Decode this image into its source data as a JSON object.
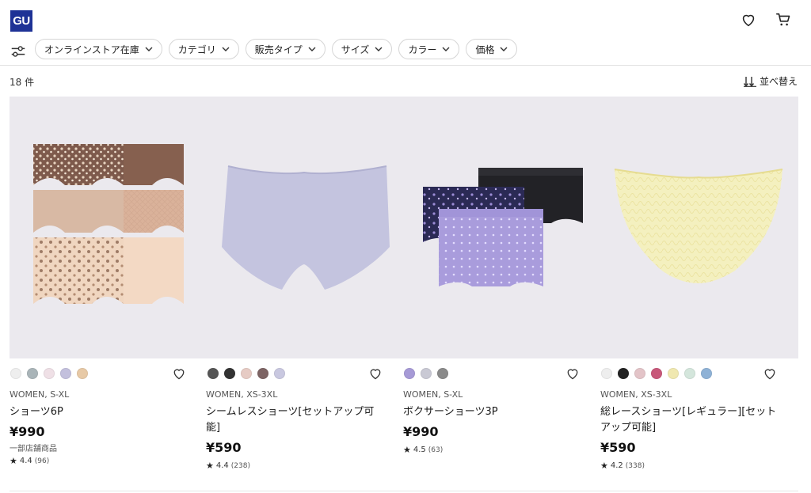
{
  "header": {
    "logo_text": "GU",
    "logo_color": "#1e3296",
    "icons": [
      "heart-icon",
      "cart-icon"
    ]
  },
  "filters": {
    "icon": "filter-sliders-icon",
    "chips": [
      {
        "label": "オンラインストア在庫"
      },
      {
        "label": "カテゴリ"
      },
      {
        "label": "販売タイプ"
      },
      {
        "label": "サイズ"
      },
      {
        "label": "カラー"
      },
      {
        "label": "価格"
      }
    ]
  },
  "results": {
    "count": "18 件",
    "sort_label": "並べ替え"
  },
  "products": [
    {
      "colors": [
        "#eeeeee",
        "#a9b4b8",
        "#efe0e6",
        "#c3c0dd",
        "#e7c9a6"
      ],
      "meta": "WOMEN, S-XL",
      "name": "ショーツ6P",
      "price": "¥990",
      "note": "一部店舗商品",
      "rating": "4.4",
      "reviews": "(96)"
    },
    {
      "colors": [
        "#555555",
        "#333333",
        "#e6cbc4",
        "#7d6464",
        "#c9c8e0"
      ],
      "meta": "WOMEN, XS-3XL",
      "name": "シームレスショーツ[セットアップ可能]",
      "price": "¥590",
      "note": "",
      "rating": "4.4",
      "reviews": "(238)"
    },
    {
      "colors": [
        "#a69ad6",
        "#c9c9d4",
        "#8a8a8a"
      ],
      "meta": "WOMEN, S-XL",
      "name": "ボクサーショーツ3P",
      "price": "¥990",
      "note": "",
      "rating": "4.5",
      "reviews": "(63)"
    },
    {
      "colors": [
        "#eeeeee",
        "#222222",
        "#e3c4c8",
        "#c8587a",
        "#f0e8b0",
        "#d4e6dc",
        "#8fb2d6"
      ],
      "meta": "WOMEN, XS-3XL",
      "name": "総レースショーツ[レギュラー][セットアップ可能]",
      "price": "¥590",
      "note": "",
      "rating": "4.2",
      "reviews": "(338)"
    }
  ]
}
